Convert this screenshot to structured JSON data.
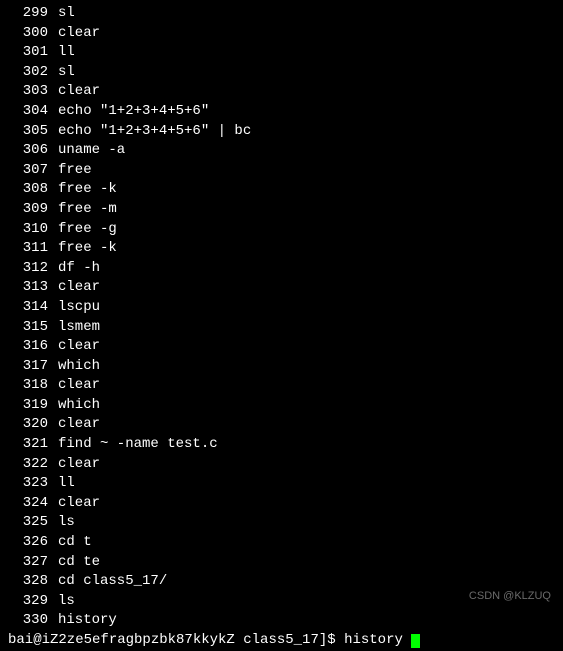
{
  "history": [
    {
      "num": "299",
      "cmd": "sl"
    },
    {
      "num": "300",
      "cmd": "clear"
    },
    {
      "num": "301",
      "cmd": "ll"
    },
    {
      "num": "302",
      "cmd": "sl"
    },
    {
      "num": "303",
      "cmd": "clear"
    },
    {
      "num": "304",
      "cmd": "echo \"1+2+3+4+5+6\""
    },
    {
      "num": "305",
      "cmd": "echo \"1+2+3+4+5+6\" | bc"
    },
    {
      "num": "306",
      "cmd": "uname -a"
    },
    {
      "num": "307",
      "cmd": "free"
    },
    {
      "num": "308",
      "cmd": "free -k"
    },
    {
      "num": "309",
      "cmd": "free -m"
    },
    {
      "num": "310",
      "cmd": "free -g"
    },
    {
      "num": "311",
      "cmd": "free -k"
    },
    {
      "num": "312",
      "cmd": "df -h"
    },
    {
      "num": "313",
      "cmd": "clear"
    },
    {
      "num": "314",
      "cmd": "lscpu"
    },
    {
      "num": "315",
      "cmd": "lsmem"
    },
    {
      "num": "316",
      "cmd": "clear"
    },
    {
      "num": "317",
      "cmd": "which"
    },
    {
      "num": "318",
      "cmd": "clear"
    },
    {
      "num": "319",
      "cmd": "which"
    },
    {
      "num": "320",
      "cmd": "clear"
    },
    {
      "num": "321",
      "cmd": "find ~ -name test.c"
    },
    {
      "num": "322",
      "cmd": "clear"
    },
    {
      "num": "323",
      "cmd": "ll"
    },
    {
      "num": "324",
      "cmd": "clear"
    },
    {
      "num": "325",
      "cmd": "ls"
    },
    {
      "num": "326",
      "cmd": "cd t"
    },
    {
      "num": "327",
      "cmd": "cd te"
    },
    {
      "num": "328",
      "cmd": "cd class5_17/"
    },
    {
      "num": "329",
      "cmd": "ls"
    },
    {
      "num": "330",
      "cmd": "history"
    }
  ],
  "prompt": {
    "text": "bai@iZ2ze5efragbpzbk87kkykZ class5_17]$ ",
    "current_cmd": "history "
  },
  "watermark": "CSDN @KLZUQ"
}
